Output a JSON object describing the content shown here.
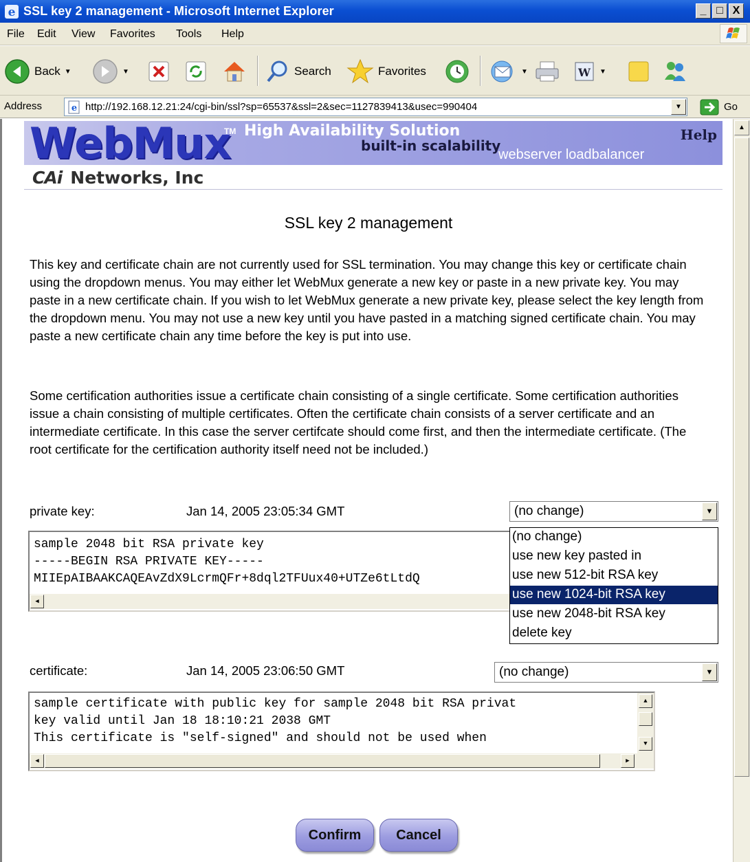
{
  "window": {
    "title": "SSL key 2 management - Microsoft Internet Explorer",
    "buttons": {
      "minimize": "_",
      "maximize": "□",
      "close": "X"
    }
  },
  "menu": [
    "File",
    "Edit",
    "View",
    "Favorites",
    "Tools",
    "Help"
  ],
  "toolbar": {
    "back": "Back",
    "search": "Search",
    "favorites": "Favorites"
  },
  "address": {
    "label": "Address",
    "url": "http://192.168.12.21:24/cgi-bin/ssl?sp=65537&ssl=2&sec=1127839413&usec=990404",
    "go": "Go"
  },
  "banner": {
    "brand": "WebMux",
    "tm": "TM",
    "tagline": "High Availability Solution",
    "tagline2": "built-in scalability",
    "tagline3": "webserver loadbalancer",
    "help": "Help",
    "company_logo": "CAi",
    "company_name": "Networks, Inc"
  },
  "page": {
    "title": "SSL key 2 management",
    "para1": "This key and certificate chain are not currently used for SSL termination. You may change this key or certificate chain using the dropdown menus. You may either let WebMux generate a new key or paste in a new private key. You may paste in a new certificate chain. If you wish to let WebMux generate a new private key, please select the key length from the dropdown menu. You may not use a new key until you have pasted in a matching signed certificate chain. You may paste a new certificate chain any time before the key is put into use.",
    "para2": "Some certification authorities issue a certificate chain consisting of a single certificate. Some certification authorities issue a chain consisting of multiple certificates. Often the certificate chain consists of a server certificate and an intermediate certificate. In this case the server certifcate should come first, and then the intermediate certificate. (The root certificate for the certification authority itself need not be included.)"
  },
  "private_key": {
    "label": "private key:",
    "date": "Jan 14, 2005 23:05:34 GMT",
    "selected": "(no change)",
    "options": [
      "(no change)",
      "use new key pasted in",
      "use new 512-bit RSA key",
      "use new 1024-bit RSA key",
      "use new 2048-bit RSA key",
      "delete key"
    ],
    "highlighted_index": 3,
    "text_lines": [
      "sample 2048 bit RSA private key",
      "-----BEGIN RSA PRIVATE KEY-----",
      "MIIEpAIBAAKCAQEAvZdX9LcrmQFr+8dql2TFUux40+UTZe6tLtdQ"
    ]
  },
  "certificate": {
    "label": "certificate:",
    "date": "Jan 14, 2005 23:06:50 GMT",
    "selected": "(no change)",
    "text_lines": [
      "sample certificate with public key for sample 2048 bit RSA privat",
      "key valid until Jan 18 18:10:21 2038 GMT",
      "This certificate is \"self-signed\" and should not be used when"
    ]
  },
  "actions": {
    "confirm": "Confirm",
    "cancel": "Cancel"
  }
}
